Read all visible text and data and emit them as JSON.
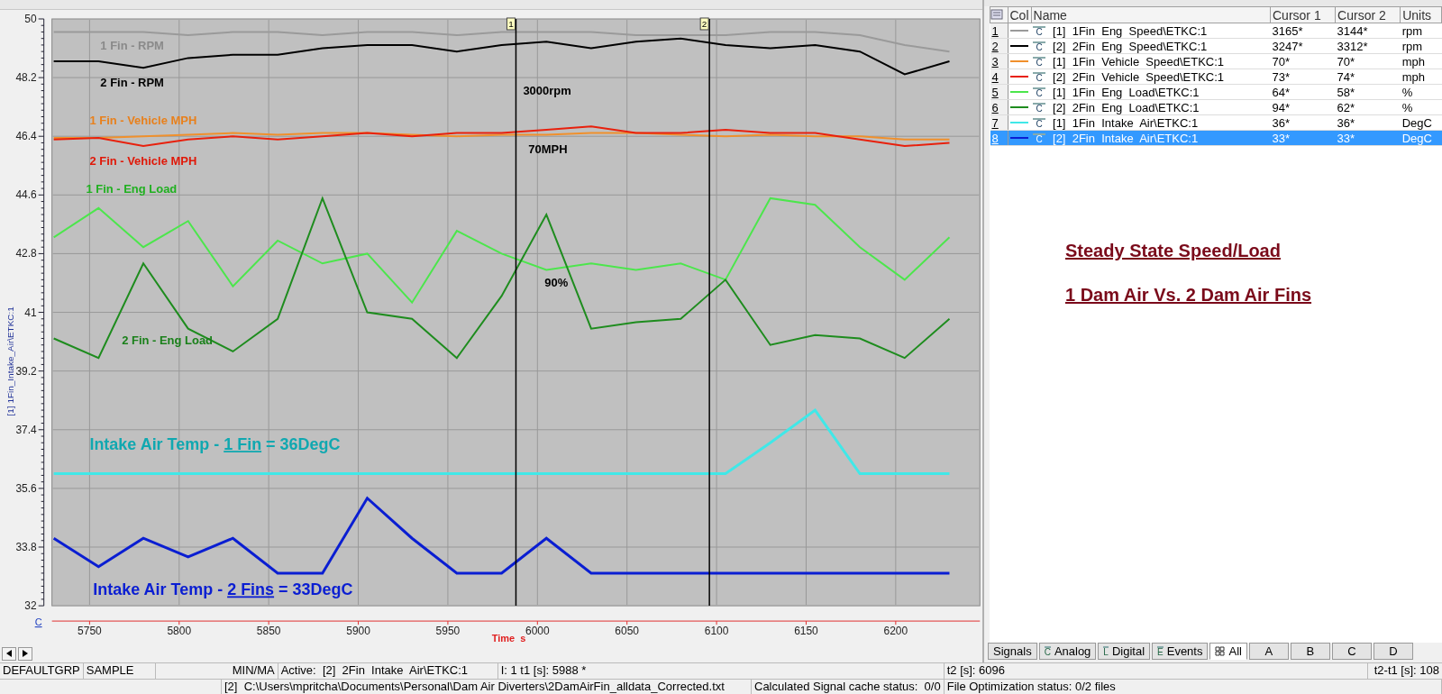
{
  "chart": {
    "chart_data": {
      "type": "line",
      "ylabel": "[1] 1Fin_Intake_Air\\ETKC:1",
      "xlabel": "Time  s",
      "grid": true,
      "x": [
        5730,
        5755,
        5780,
        5805,
        5830,
        5855,
        5880,
        5905,
        5930,
        5955,
        5980,
        6005,
        6030,
        6055,
        6080,
        6105,
        6130,
        6155,
        6180,
        6205,
        6230
      ],
      "series": [
        {
          "color": "#9a9a9a",
          "values": [
            49.6,
            49.6,
            49.6,
            49.5,
            49.6,
            49.6,
            49.5,
            49.6,
            49.6,
            49.5,
            49.6,
            49.6,
            49.6,
            49.5,
            49.5,
            49.5,
            49.6,
            49.6,
            49.5,
            49.2,
            49.0
          ]
        },
        {
          "color": "#000000",
          "values": [
            48.7,
            48.7,
            48.5,
            48.8,
            48.9,
            48.9,
            49.1,
            49.2,
            49.2,
            49.0,
            49.2,
            49.3,
            49.1,
            49.3,
            49.4,
            49.2,
            49.1,
            49.2,
            49.0,
            48.3,
            48.7
          ]
        },
        {
          "color": "#f0902c",
          "values": [
            46.35,
            46.35,
            46.4,
            46.45,
            46.5,
            46.45,
            46.5,
            46.5,
            46.45,
            46.4,
            46.45,
            46.45,
            46.5,
            46.5,
            46.45,
            46.4,
            46.45,
            46.4,
            46.4,
            46.3,
            46.3
          ]
        },
        {
          "color": "#e8200c",
          "values": [
            46.3,
            46.35,
            46.1,
            46.3,
            46.4,
            46.3,
            46.4,
            46.5,
            46.4,
            46.5,
            46.5,
            46.6,
            46.7,
            46.5,
            46.5,
            46.6,
            46.5,
            46.5,
            46.3,
            46.1,
            46.2
          ]
        },
        {
          "color": "#4ce64c",
          "values": [
            43.3,
            44.2,
            43.0,
            43.8,
            41.8,
            43.2,
            42.5,
            42.8,
            41.3,
            43.5,
            42.8,
            42.3,
            42.5,
            42.3,
            42.5,
            42.0,
            44.5,
            44.3,
            43.0,
            42.0,
            43.3
          ]
        },
        {
          "color": "#1e8c1e",
          "values": [
            40.2,
            39.6,
            42.5,
            40.5,
            39.8,
            40.8,
            44.5,
            41.0,
            40.8,
            39.6,
            41.5,
            44.0,
            40.5,
            40.7,
            40.8,
            42.0,
            40.0,
            40.3,
            40.2,
            39.6,
            40.8
          ]
        },
        {
          "color": "#40e8e8",
          "values": [
            36.05,
            36.05,
            36.05,
            36.05,
            36.05,
            36.05,
            36.05,
            36.05,
            36.05,
            36.05,
            36.05,
            36.05,
            36.05,
            36.05,
            36.05,
            36.05,
            37.0,
            38.0,
            36.05,
            36.05,
            36.05
          ]
        },
        {
          "color": "#0a1ed2",
          "values": [
            34.07,
            33.2,
            34.07,
            33.5,
            34.07,
            33.0,
            33.0,
            35.3,
            34.07,
            33.0,
            33.0,
            34.07,
            33.0,
            33.0,
            33.0,
            33.0,
            33.0,
            33.0,
            33.0,
            33.0,
            33.0
          ]
        }
      ],
      "xlim": [
        5729,
        6247
      ],
      "ylim": [
        32,
        50
      ],
      "xticks": [
        5750,
        5800,
        5850,
        5900,
        5950,
        6000,
        6050,
        6100,
        6150,
        6200
      ],
      "yticks": [
        32,
        33.8,
        35.6,
        37.4,
        39.2,
        41,
        42.8,
        44.6,
        46.4,
        48.2,
        50
      ],
      "ref_lines": [
        {
          "axis": "x",
          "value": 5988
        },
        {
          "axis": "x",
          "value": 6096
        }
      ]
    },
    "cursor_markers": [
      "1",
      "2"
    ],
    "trace_labels": [
      {
        "kind": "small",
        "color": "#8a8a8a",
        "parts": [
          {
            "text": "1 Fin - RPM",
            "underline": false
          }
        ]
      },
      {
        "kind": "small",
        "color": "#000000",
        "parts": [
          {
            "text": "2 Fin - RPM",
            "underline": false
          }
        ]
      },
      {
        "kind": "small",
        "color": "#e8801c",
        "parts": [
          {
            "text": "1 Fin - Vehicle MPH",
            "underline": false
          }
        ]
      },
      {
        "kind": "small",
        "color": "#e01808",
        "parts": [
          {
            "text": "2 Fin - Vehicle MPH",
            "underline": false
          }
        ]
      },
      {
        "kind": "small",
        "color": "#20b020",
        "parts": [
          {
            "text": "1 Fin - Eng Load",
            "underline": false
          }
        ]
      },
      {
        "kind": "small",
        "color": "#1a801a",
        "parts": [
          {
            "text": "2 Fin - Eng Load",
            "underline": false
          }
        ]
      },
      {
        "kind": "small",
        "color": "#000000",
        "parts": [
          {
            "text": "3000rpm",
            "underline": false
          }
        ]
      },
      {
        "kind": "small",
        "color": "#000000",
        "parts": [
          {
            "text": "70MPH",
            "underline": false
          }
        ]
      },
      {
        "kind": "small",
        "color": "#000000",
        "parts": [
          {
            "text": "90%",
            "underline": false
          }
        ]
      },
      {
        "kind": "large",
        "color": "#10a8b0",
        "parts": [
          {
            "text": "Intake Air Temp - ",
            "underline": false
          },
          {
            "text": "1 Fin",
            "underline": true
          },
          {
            "text": " = 36DegC",
            "underline": false
          }
        ]
      },
      {
        "kind": "large",
        "color": "#0a1ed2",
        "parts": [
          {
            "text": "Intake Air Temp - ",
            "underline": false
          },
          {
            "text": "2 Fins",
            "underline": true
          },
          {
            "text": " = 33DegC",
            "underline": false
          }
        ]
      }
    ],
    "corner_link": "C"
  },
  "signal_table": {
    "columns": [
      "Col",
      "Name",
      "Cursor 1",
      "Cursor 2",
      "Units"
    ],
    "rows": [
      {
        "index": "1",
        "color": "#9a9a9a",
        "glyph": "C",
        "name": "[1]  1Fin  Eng  Speed\\ETKC:1",
        "cursor_1": "3165*",
        "cursor_2": "3144*",
        "units": "rpm",
        "selected": false
      },
      {
        "index": "2",
        "color": "#000000",
        "glyph": "C",
        "name": "[2]  2Fin  Eng  Speed\\ETKC:1",
        "cursor_1": "3247*",
        "cursor_2": "3312*",
        "units": "rpm",
        "selected": false
      },
      {
        "index": "3",
        "color": "#f0902c",
        "glyph": "C",
        "name": "[1]  1Fin  Vehicle  Speed\\ETKC:1",
        "cursor_1": "70*",
        "cursor_2": "70*",
        "units": "mph",
        "selected": false
      },
      {
        "index": "4",
        "color": "#e8200c",
        "glyph": "C",
        "name": "[2]  2Fin  Vehicle  Speed\\ETKC:1",
        "cursor_1": "73*",
        "cursor_2": "74*",
        "units": "mph",
        "selected": false
      },
      {
        "index": "5",
        "color": "#4ce64c",
        "glyph": "C",
        "name": "[1]  1Fin  Eng  Load\\ETKC:1",
        "cursor_1": "64*",
        "cursor_2": "58*",
        "units": "%",
        "selected": false
      },
      {
        "index": "6",
        "color": "#1e8c1e",
        "glyph": "C",
        "name": "[2]  2Fin  Eng  Load\\ETKC:1",
        "cursor_1": "94*",
        "cursor_2": "62*",
        "units": "%",
        "selected": false
      },
      {
        "index": "7",
        "color": "#40e8e8",
        "glyph": "C",
        "name": "[1]  1Fin  Intake  Air\\ETKC:1",
        "cursor_1": "36*",
        "cursor_2": "36*",
        "units": "DegC",
        "selected": false
      },
      {
        "index": "8",
        "color": "#0a1ed2",
        "glyph": "C",
        "name": "[2]  2Fin  Intake  Air\\ETKC:1",
        "cursor_1": "33*",
        "cursor_2": "33*",
        "units": "DegC",
        "selected": true
      }
    ]
  },
  "notes": [
    "Steady State Speed/Load",
    "1 Dam Air Vs. 2 Dam Air Fins"
  ],
  "tabs": [
    {
      "label": "Signals",
      "kind": "text",
      "selected": false
    },
    {
      "label": "Analog",
      "kind": "glyph",
      "glyph": "C",
      "selected": false
    },
    {
      "label": "Digital",
      "kind": "glyph",
      "glyph": "L",
      "selected": false
    },
    {
      "label": "Events",
      "kind": "glyph",
      "glyph": "E",
      "selected": false
    },
    {
      "label": "All",
      "kind": "grid",
      "selected": true
    },
    {
      "label": "A",
      "kind": "text",
      "selected": false
    },
    {
      "label": "B",
      "kind": "text",
      "selected": false
    },
    {
      "label": "C",
      "kind": "text",
      "selected": false
    },
    {
      "label": "D",
      "kind": "text",
      "selected": false
    }
  ],
  "status_bar": {
    "row_1": [
      "DEFAULTGRP",
      "SAMPLE",
      "MIN/MA",
      "Active:  [2]  2Fin  Intake  Air\\ETKC:1",
      "I: 1 t1 [s]: 5988 *",
      "t2 [s]: 6096",
      "t2-t1 [s]: 108"
    ],
    "row_2": [
      "[2]  C:\\Users\\mpritcha\\Documents\\Personal\\Dam Air Diverters\\2DamAirFin_alldata_Corrected.txt",
      "Calculated Signal cache status:  0/0",
      "File Optimization status: 0/2 files"
    ]
  }
}
